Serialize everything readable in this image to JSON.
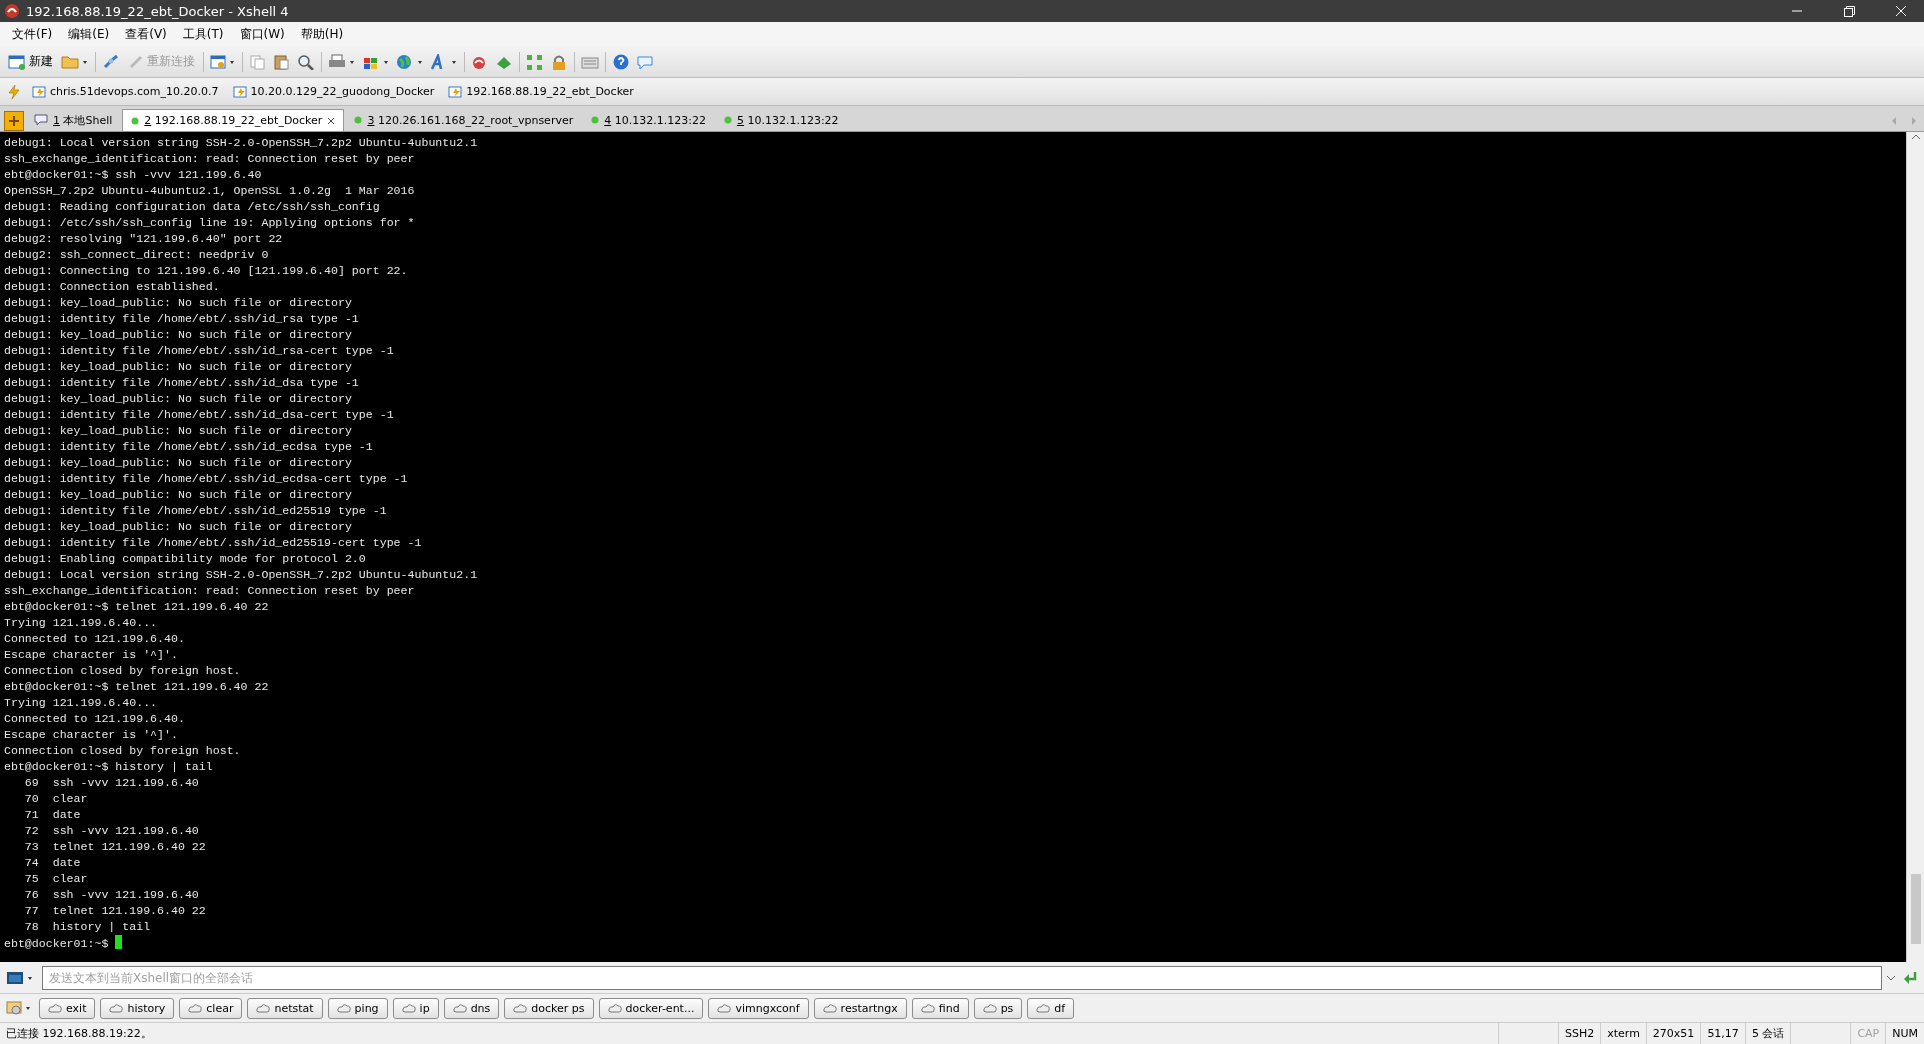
{
  "window": {
    "title": "192.168.88.19_22_ebt_Docker - Xshell 4"
  },
  "menu": [
    "文件(F)",
    "编辑(E)",
    "查看(V)",
    "工具(T)",
    "窗口(W)",
    "帮助(H)"
  ],
  "toolbar": {
    "new_label": "新建",
    "reconnect_label": "重新连接",
    "reconnect_disabled": true
  },
  "links": [
    "chris.51devops.com_10.20.0.7",
    "10.20.0.129_22_guodong_Docker",
    "192.168.88.19_22_ebt_Docker"
  ],
  "tabs": [
    {
      "number": "1",
      "label": "本地Shell",
      "kind": "local",
      "selected": false
    },
    {
      "number": "2",
      "label": "192.168.88.19_22_ebt_Docker",
      "kind": "remote",
      "selected": true
    },
    {
      "number": "3",
      "label": "120.26.161.168_22_root_vpnserver",
      "kind": "remote",
      "selected": false
    },
    {
      "number": "4",
      "label": "10.132.1.123:22",
      "kind": "remote",
      "selected": false
    },
    {
      "number": "5",
      "label": "10.132.1.123:22",
      "kind": "remote",
      "selected": false
    }
  ],
  "terminal": {
    "cursor": true,
    "lines": [
      "debug1: Local version string SSH-2.0-OpenSSH_7.2p2 Ubuntu-4ubuntu2.1",
      "ssh_exchange_identification: read: Connection reset by peer",
      "ebt@docker01:~$ ssh -vvv 121.199.6.40",
      "OpenSSH_7.2p2 Ubuntu-4ubuntu2.1, OpenSSL 1.0.2g  1 Mar 2016",
      "debug1: Reading configuration data /etc/ssh/ssh_config",
      "debug1: /etc/ssh/ssh_config line 19: Applying options for *",
      "debug2: resolving \"121.199.6.40\" port 22",
      "debug2: ssh_connect_direct: needpriv 0",
      "debug1: Connecting to 121.199.6.40 [121.199.6.40] port 22.",
      "debug1: Connection established.",
      "debug1: key_load_public: No such file or directory",
      "debug1: identity file /home/ebt/.ssh/id_rsa type -1",
      "debug1: key_load_public: No such file or directory",
      "debug1: identity file /home/ebt/.ssh/id_rsa-cert type -1",
      "debug1: key_load_public: No such file or directory",
      "debug1: identity file /home/ebt/.ssh/id_dsa type -1",
      "debug1: key_load_public: No such file or directory",
      "debug1: identity file /home/ebt/.ssh/id_dsa-cert type -1",
      "debug1: key_load_public: No such file or directory",
      "debug1: identity file /home/ebt/.ssh/id_ecdsa type -1",
      "debug1: key_load_public: No such file or directory",
      "debug1: identity file /home/ebt/.ssh/id_ecdsa-cert type -1",
      "debug1: key_load_public: No such file or directory",
      "debug1: identity file /home/ebt/.ssh/id_ed25519 type -1",
      "debug1: key_load_public: No such file or directory",
      "debug1: identity file /home/ebt/.ssh/id_ed25519-cert type -1",
      "debug1: Enabling compatibility mode for protocol 2.0",
      "debug1: Local version string SSH-2.0-OpenSSH_7.2p2 Ubuntu-4ubuntu2.1",
      "ssh_exchange_identification: read: Connection reset by peer",
      "ebt@docker01:~$ telnet 121.199.6.40 22",
      "Trying 121.199.6.40...",
      "Connected to 121.199.6.40.",
      "Escape character is '^]'.",
      "Connection closed by foreign host.",
      "ebt@docker01:~$ telnet 121.199.6.40 22",
      "Trying 121.199.6.40...",
      "Connected to 121.199.6.40.",
      "Escape character is '^]'.",
      "Connection closed by foreign host.",
      "ebt@docker01:~$ history | tail",
      "   69  ssh -vvv 121.199.6.40",
      "   70  clear",
      "   71  date",
      "   72  ssh -vvv 121.199.6.40",
      "   73  telnet 121.199.6.40 22",
      "   74  date",
      "   75  clear",
      "   76  ssh -vvv 121.199.6.40",
      "   77  telnet 121.199.6.40 22",
      "   78  history | tail",
      "ebt@docker01:~$ "
    ]
  },
  "compose": {
    "placeholder": "发送文本到当前Xshell窗口的全部会话"
  },
  "quick_commands": [
    "exit",
    "history",
    "clear",
    "netstat",
    "ping",
    "ip",
    "dns",
    "docker ps",
    "docker-ent...",
    "vimngxconf",
    "restartngx",
    "find",
    "ps",
    "df"
  ],
  "status_bar": {
    "message": "已连接 192.168.88.19:22。",
    "panes": [
      {
        "text": "SSH2",
        "on": true
      },
      {
        "text": "xterm",
        "on": true
      },
      {
        "text": "270x51",
        "on": true
      },
      {
        "text": "51,17",
        "on": true
      },
      {
        "text": "5 会话",
        "on": true
      },
      {
        "text": "CAP",
        "on": false
      },
      {
        "text": "NUM",
        "on": true
      }
    ]
  }
}
